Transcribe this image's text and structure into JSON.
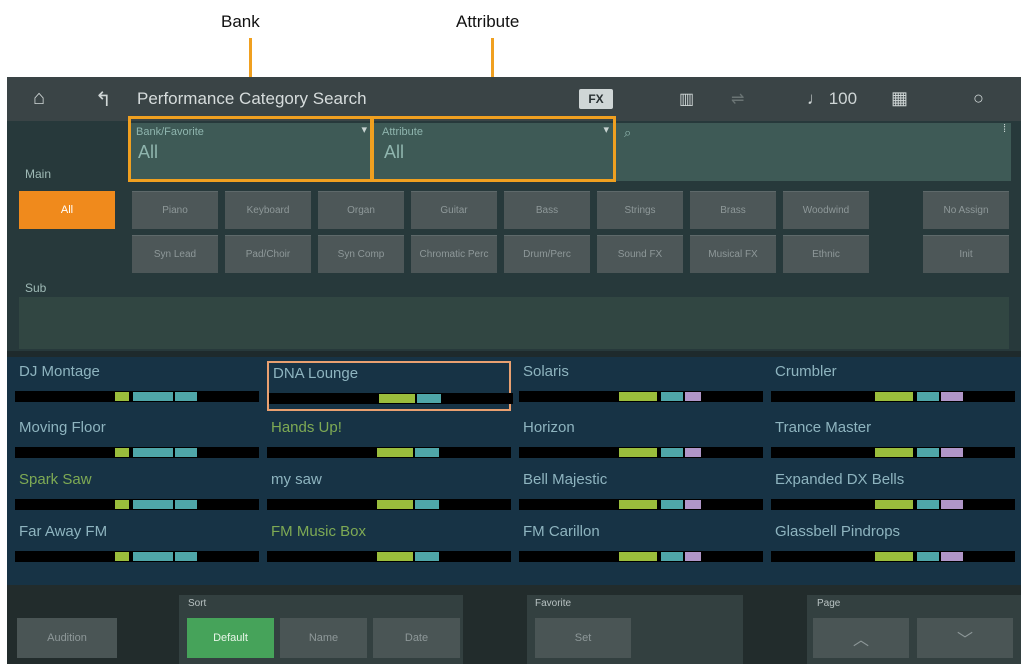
{
  "callouts": {
    "bank": "Bank",
    "attribute": "Attribute"
  },
  "header": {
    "home_icon": "home-icon",
    "back_icon": "back-arrow-icon",
    "title": "Performance Category Search",
    "fx_label": "FX",
    "tempo": "♩ 100"
  },
  "filters": {
    "bank": {
      "caption": "Bank/Favorite",
      "value": "All"
    },
    "attribute": {
      "caption": "Attribute",
      "value": "All"
    },
    "search_icon": "⌕",
    "search_value": ""
  },
  "main_label": "Main",
  "sub_label": "Sub",
  "all_label": "All",
  "main_categories": [
    "Piano",
    "Keyboard",
    "Organ",
    "Guitar",
    "Bass",
    "Strings",
    "Brass",
    "Woodwind",
    "No Assign"
  ],
  "sub_categories": [
    "Syn Lead",
    "Pad/Choir",
    "Syn Comp",
    "Chromatic Perc",
    "Drum/Perc",
    "Sound FX",
    "Musical FX",
    "Ethnic",
    "Init"
  ],
  "performances": [
    {
      "name": "DJ Montage",
      "green": false
    },
    {
      "name": "DNA Lounge",
      "green": false,
      "selected": true
    },
    {
      "name": "Solaris",
      "green": false
    },
    {
      "name": "Crumbler",
      "green": false
    },
    {
      "name": "Moving Floor",
      "green": false
    },
    {
      "name": "Hands Up!",
      "green": true
    },
    {
      "name": "Horizon",
      "green": false
    },
    {
      "name": "Trance Master",
      "green": false
    },
    {
      "name": "Spark Saw",
      "green": true
    },
    {
      "name": "my saw",
      "green": false
    },
    {
      "name": "Bell Majestic",
      "green": false
    },
    {
      "name": "Expanded DX Bells",
      "green": false
    },
    {
      "name": "Far Away FM",
      "green": false
    },
    {
      "name": "FM Music Box",
      "green": true
    },
    {
      "name": "FM Carillon",
      "green": false
    },
    {
      "name": "Glassbell Pindrops",
      "green": false
    }
  ],
  "bottom": {
    "audition": "Audition",
    "sort_title": "Sort",
    "sort_default": "Default",
    "sort_name": "Name",
    "sort_date": "Date",
    "favorite_title": "Favorite",
    "favorite_set": "Set",
    "page_title": "Page",
    "page_up_icon": "chevron-up-icon",
    "page_down_icon": "chevron-down-icon"
  },
  "colors": {
    "accent": "#f0a020",
    "all_button": "#f08a1c",
    "active_sort": "#46a35a"
  }
}
